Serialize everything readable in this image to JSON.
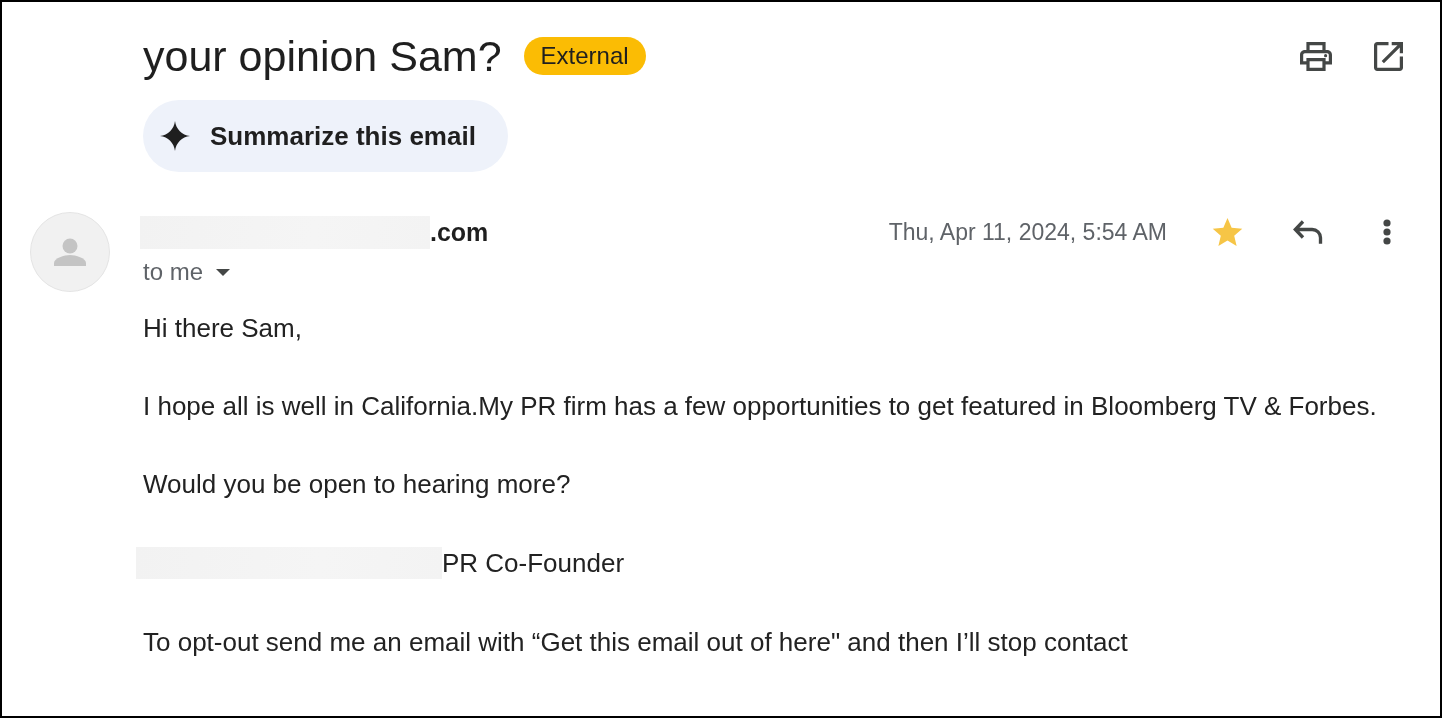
{
  "subject": {
    "title": "your opinion Sam?",
    "label": "External"
  },
  "summarize_button": {
    "label": "Summarize this email"
  },
  "message": {
    "sender": {
      "text": ".com",
      "redacted": true
    },
    "recipient": "to me",
    "date": "Thu, Apr 11, 2024, 5:54 AM",
    "starred": true,
    "body": [
      {
        "text": "Hi there Sam,",
        "redacted": false
      },
      {
        "text": "I hope all is well in California.My PR firm has a few opportunities to get featured in Bloomberg TV & Forbes.",
        "redacted": false
      },
      {
        "text": "Would you be open to hearing more?",
        "redacted": false
      },
      {
        "text": "PR Co-Founder",
        "redacted": true
      },
      {
        "text": "To opt-out send me an email with “Get this email out of here\" and then I’ll stop contact",
        "redacted": false
      }
    ]
  }
}
